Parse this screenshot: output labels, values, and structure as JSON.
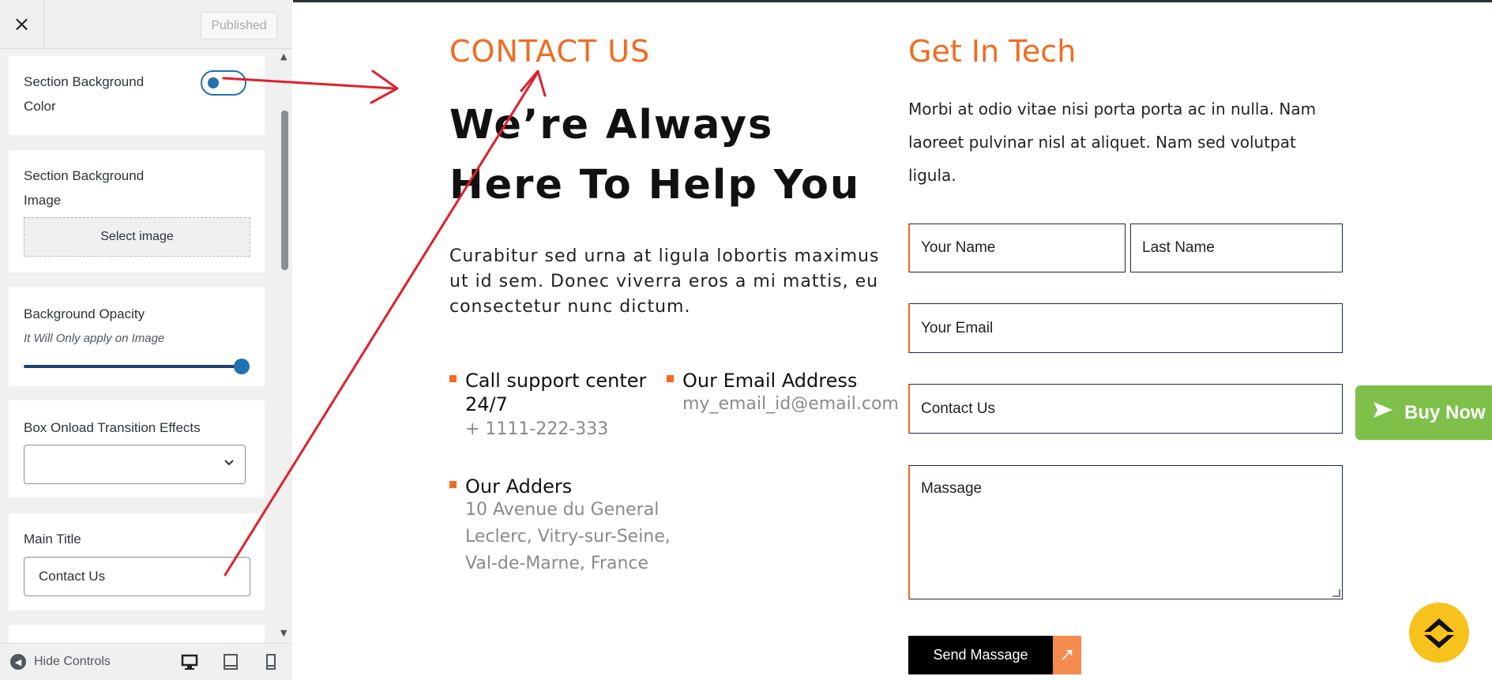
{
  "sidebar": {
    "close_icon": "×",
    "published_label": "Published",
    "section_bg_color_label": "Section Background Color",
    "section_bg_image_label": "Section Background Image",
    "select_image_label": "Select image",
    "bg_opacity_label": "Background Opacity",
    "bg_opacity_note": "It Will Only apply on Image",
    "bg_opacity_value": 1.0,
    "box_transition_label": "Box Onload Transition Effects",
    "box_transition_value": "",
    "main_title_label": "Main Title",
    "main_title_value": "Contact Us",
    "hide_controls_label": "Hide Controls",
    "device_icons": [
      "desktop-icon",
      "tablet-icon",
      "mobile-icon"
    ]
  },
  "preview": {
    "contact_kicker": "CONTACT US",
    "main_heading": "We’re Always Here To Help You",
    "intro_text": "Curabitur sed urna at ligula lobortis maximus ut id sem. Donec viverra eros a mi mattis, eu consectetur nunc dictum.",
    "support_title": "Call support center 24/7",
    "support_value": "+ 1111-222-333",
    "email_title": "Our Email Address",
    "email_value": "my_email_id@email.com",
    "address_title": "Our Adders",
    "address_value": "10 Avenue du General Leclerc, Vitry-sur-Seine, Val-de-Marne, France",
    "get_in_tech": "Get In Tech",
    "right_desc": "Morbi at odio vitae nisi porta porta ac in nulla. Nam laoreet pulvinar nisl at aliquet. Nam sed volutpat ligula.",
    "form": {
      "first_name_placeholder": "Your Name",
      "last_name_placeholder": "Last Name",
      "email_placeholder": "Your Email",
      "subject_placeholder": "Contact Us",
      "message_placeholder": "Massage",
      "send_label": "Send Massage"
    },
    "buy_now_label": "Buy Now"
  },
  "colors": {
    "accent_orange": "#f26b21",
    "wp_blue": "#2271b1",
    "buy_now_green": "#7ec04a",
    "fab_yellow": "#f7c21b",
    "annotation_red": "#e0202b"
  }
}
